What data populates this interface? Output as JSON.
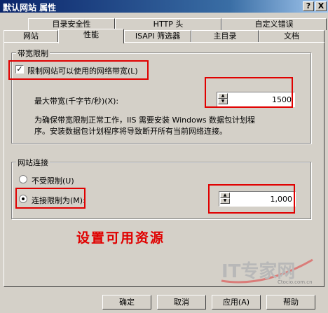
{
  "window": {
    "title": "默认网站 属性",
    "help_btn": "?",
    "close_btn": "X"
  },
  "tabs_row1": [
    "目录安全性",
    "HTTP 头",
    "自定义错误"
  ],
  "tabs_row2": [
    "网站",
    "性能",
    "ISAPI 筛选器",
    "主目录",
    "文档"
  ],
  "bandwidth": {
    "group_label": "带宽限制",
    "checkbox_label": "限制网站可以使用的网络带宽(L)",
    "checked": true,
    "max_label": "最大带宽(千字节/秒)(X):",
    "max_value": "1500",
    "note_line1": "为确保带宽限制正常工作，IIS 需要安装 Windows 数据包计划程",
    "note_line2": "序。安装数据包计划程序将导致断开所有当前网络连接。"
  },
  "connections": {
    "group_label": "网站连接",
    "unlimited_label": "不受限制(U)",
    "limit_label": "连接限制为(M):",
    "limit_value": "1,000",
    "selected": "limit"
  },
  "annotation": "设置可用资源",
  "watermark": {
    "brand": "IT专家网",
    "site": "Ctocio.com.cn"
  },
  "buttons": {
    "ok": "确定",
    "cancel": "取消",
    "apply": "应用(A)",
    "help": "帮助"
  },
  "colors": {
    "highlight": "#e00000",
    "title_bar": "#0a246a",
    "annotation": "#e00000"
  }
}
